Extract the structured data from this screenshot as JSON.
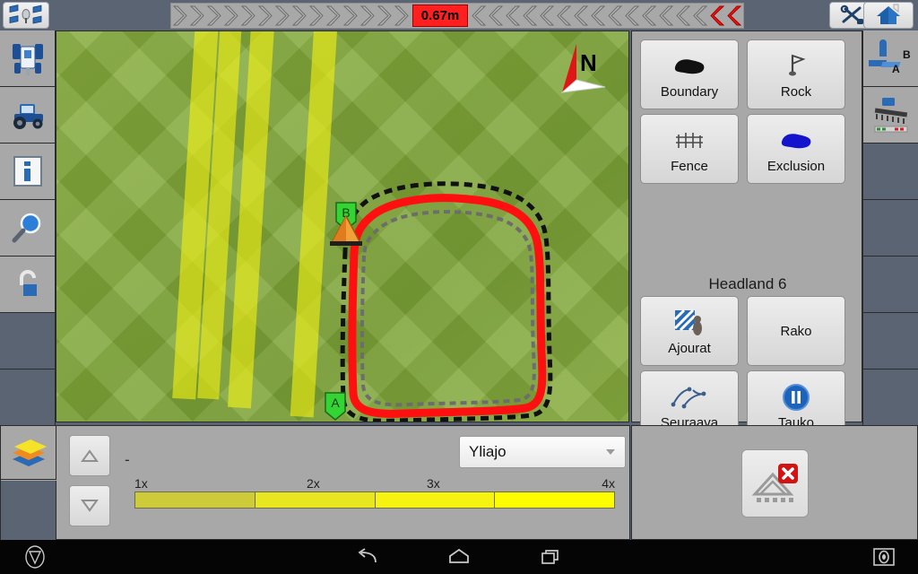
{
  "topbar": {
    "gps_icon": "satellite-icon",
    "tools_icon": "tools-icon",
    "home_icon": "home-icon",
    "lightbar": {
      "offset_value": "0.67m",
      "left_chevrons": 14,
      "right_chevrons": 16,
      "active_red_chevrons": 2,
      "chevron_color": "#b4b4b4",
      "active_color": "#ff1010",
      "offset_bg": "#ff1f1f"
    }
  },
  "left_rail": {
    "items": [
      {
        "name": "vehicle-top-view",
        "icon": "tractor-top-icon"
      },
      {
        "name": "vehicle-side-view",
        "icon": "tractor-side-icon"
      },
      {
        "name": "info-panel",
        "icon": "info-icon"
      },
      {
        "name": "zoom-tool",
        "icon": "magnifier-icon"
      },
      {
        "name": "unlock",
        "icon": "padlock-open-icon"
      },
      {
        "name": "empty-slot-1",
        "icon": ""
      },
      {
        "name": "empty-slot-2",
        "icon": ""
      }
    ]
  },
  "map": {
    "compass_label": "N",
    "marker_a": "A",
    "marker_b": "B",
    "field_color": "#7ca337",
    "coverage_color": "#f0f014",
    "guidance_line_color": "#ff1010",
    "boundary_color": "#111111",
    "headland_line_color": "#666666",
    "vehicle_color": "#ee8c22"
  },
  "right_panel": {
    "buttons": [
      {
        "label": "Boundary",
        "icon": "boundary-blob-icon"
      },
      {
        "label": "Rock",
        "icon": "flag-icon"
      },
      {
        "label": "Fence",
        "icon": "fence-icon"
      },
      {
        "label": "Exclusion",
        "icon": "exclusion-blob-icon"
      }
    ],
    "headland_title": "Headland 6",
    "action_buttons": [
      {
        "label": "Ajourat",
        "icon": "tramline-icon"
      },
      {
        "label": "Rako",
        "icon": ""
      },
      {
        "label": "Seuraava",
        "icon": "next-path-icon"
      },
      {
        "label": "Tauko",
        "icon": "pause-icon"
      }
    ]
  },
  "right_rail": {
    "items": [
      {
        "name": "ab-line-guidance",
        "icon": "ab-line-icon"
      },
      {
        "name": "implement-sections",
        "icon": "implement-icon"
      },
      {
        "name": "empty-slot-1",
        "icon": ""
      },
      {
        "name": "empty-slot-2",
        "icon": ""
      },
      {
        "name": "empty-slot-3",
        "icon": ""
      },
      {
        "name": "empty-slot-4",
        "icon": ""
      },
      {
        "name": "empty-slot-5",
        "icon": ""
      }
    ]
  },
  "bottom_left": {
    "layers_icon": "layers-icon",
    "step_up_icon": "triangle-up-icon",
    "step_down_icon": "triangle-down-icon",
    "value_label": "-",
    "overlap_select": {
      "value": "Yliajo",
      "chevron": "chevron-down-icon"
    },
    "legend": {
      "ticks": [
        "1x",
        "2x",
        "3x",
        "4x"
      ],
      "segment_colors": [
        "#cdcb39",
        "#e8e61f",
        "#f5f30f",
        "#fdfd00"
      ]
    }
  },
  "bottom_right": {
    "section_button": {
      "name": "sections-off-button",
      "icon": "implement-disabled-icon",
      "badge": "close-badge"
    }
  },
  "navbar": {
    "logo_icon": "app-logo-icon",
    "back_icon": "back-icon",
    "home_icon": "home-outline-icon",
    "recents_icon": "recents-icon",
    "screenshot_icon": "screenshot-icon"
  }
}
